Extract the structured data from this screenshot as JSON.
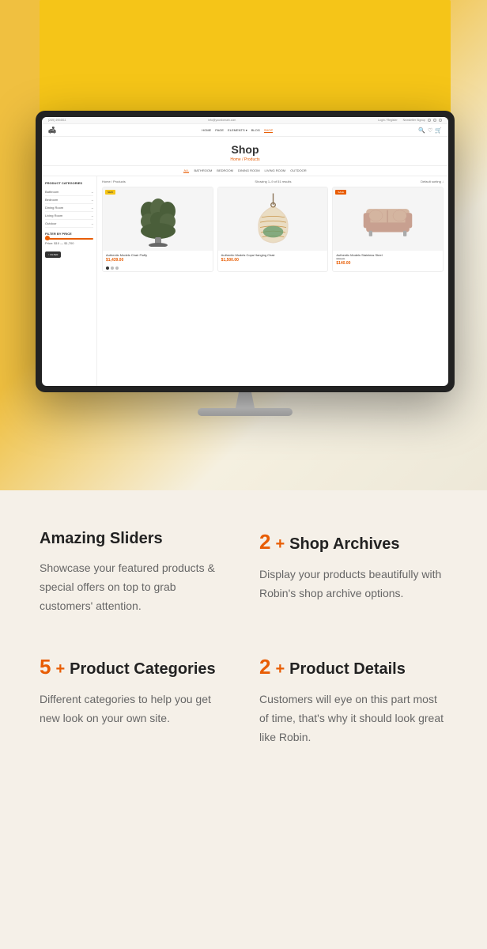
{
  "hero": {
    "monitor": {
      "topbar": {
        "phone": "(249) 4904511",
        "email": "info@yourdomain.com",
        "login": "Login / Register",
        "newsletter": "Newsletter Signup"
      },
      "nav": {
        "links": [
          "HOME",
          "PAGE",
          "ELEMENTS",
          "BLOG",
          "SHOP"
        ],
        "active": "SHOP"
      },
      "page": {
        "title": "Shop",
        "breadcrumb_home": "Home /",
        "breadcrumb_current": "Products"
      },
      "category_tabs": [
        "ALL",
        "BATHROOM",
        "BEDROOM",
        "DINING ROOM",
        "LIVING ROOM",
        "OUTDOOR"
      ],
      "sidebar": {
        "categories_title": "PRODUCT CATEGORIES",
        "categories": [
          "Bathroom",
          "Bedroom",
          "Dining Room",
          "Living Room",
          "Outdoor"
        ],
        "filter_title": "FILTER BY PRICE",
        "price_range": "Price: $10 — $1,700",
        "filter_btn": "↑ FILTER"
      },
      "main": {
        "breadcrumb": "Home / Products",
        "results": "Showing 1–9 of 51 results",
        "sort": "Default sorting ↓"
      },
      "products": [
        {
          "badge": "NEW",
          "badge_type": "new",
          "name": "Authentic Models Chair Fluffy",
          "price": "$1,439.00"
        },
        {
          "badge": "",
          "badge_type": "",
          "name": "Authentic Models Copa Hanging Chair",
          "price": "$1,500.00"
        },
        {
          "badge": "SALE",
          "badge_type": "sale",
          "name": "Authentic Models Stainless Steel",
          "price_original": "$800.00",
          "price": "$140.00"
        }
      ]
    }
  },
  "features": [
    {
      "id": "sliders",
      "number": "",
      "plus": "",
      "title": "Amazing Sliders",
      "description": "Showcase your featured products & special offers on top to grab customers' attention."
    },
    {
      "id": "shop-archives",
      "number": "2",
      "plus": "+",
      "title": "Shop Archives",
      "description": "Display your products beautifully with Robin's shop archive options."
    },
    {
      "id": "product-categories",
      "number": "5",
      "plus": "+",
      "title": "Product Categories",
      "description": "Different categories to help you get new look on your own site."
    },
    {
      "id": "product-details",
      "number": "2",
      "plus": "+",
      "title": "Product Details",
      "description": "Customers will eye on this part most of time, that's why it should look great like Robin."
    }
  ]
}
